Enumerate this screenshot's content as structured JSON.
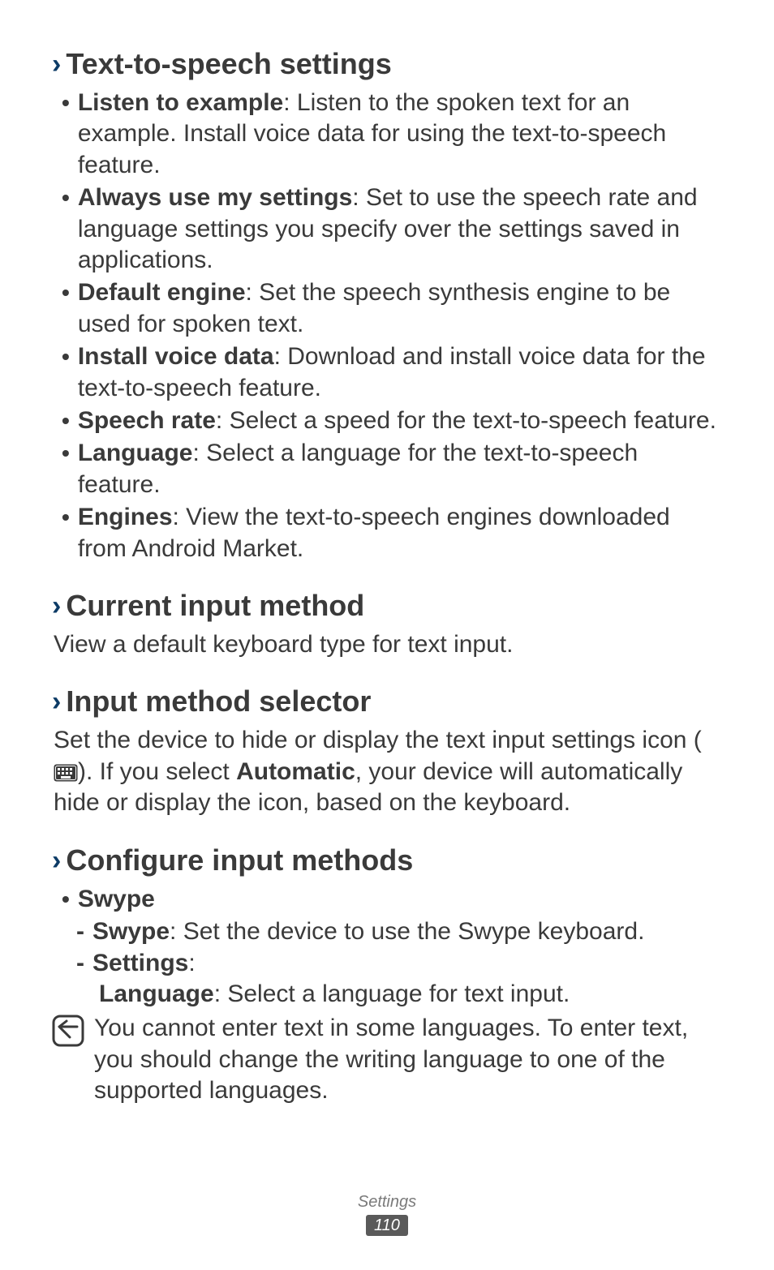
{
  "sections": {
    "tts": {
      "title": "Text-to-speech settings",
      "items": [
        {
          "label": "Listen to example",
          "desc": ": Listen to the spoken text for an example. Install voice data for using the text-to-speech feature."
        },
        {
          "label": "Always use my settings",
          "desc": ": Set to use the speech rate and language settings you specify over the settings saved in applications."
        },
        {
          "label": "Default engine",
          "desc": ": Set the speech synthesis engine to be used for spoken text."
        },
        {
          "label": "Install voice data",
          "desc": ": Download and install voice data for the text-to-speech feature."
        },
        {
          "label": "Speech rate",
          "desc": ": Select a speed for the text-to-speech feature."
        },
        {
          "label": "Language",
          "desc": ": Select a language for the text-to-speech feature."
        },
        {
          "label": "Engines",
          "desc": ": View the text-to-speech engines downloaded from Android Market."
        }
      ]
    },
    "current_input": {
      "title": "Current input method",
      "desc": "View a default keyboard type for text input."
    },
    "input_selector": {
      "title": "Input method selector",
      "desc_pre": "Set the device to hide or display the text input settings icon (",
      "desc_mid": "). If you select ",
      "auto_label": "Automatic",
      "desc_post": ", your device will automatically hide or display the icon, based on the keyboard."
    },
    "configure": {
      "title": "Configure input methods",
      "swype": {
        "label": "Swype",
        "sub": [
          {
            "label": "Swype",
            "desc": ": Set the device to use the Swype keyboard."
          },
          {
            "label": "Settings",
            "desc": ":"
          }
        ],
        "lang_label": "Language",
        "lang_desc": ": Select a language for text input."
      },
      "note": "You cannot enter text in some languages. To enter text, you should change the writing language to one of the supported languages."
    }
  },
  "footer": {
    "crumb": "Settings",
    "page": "110"
  }
}
